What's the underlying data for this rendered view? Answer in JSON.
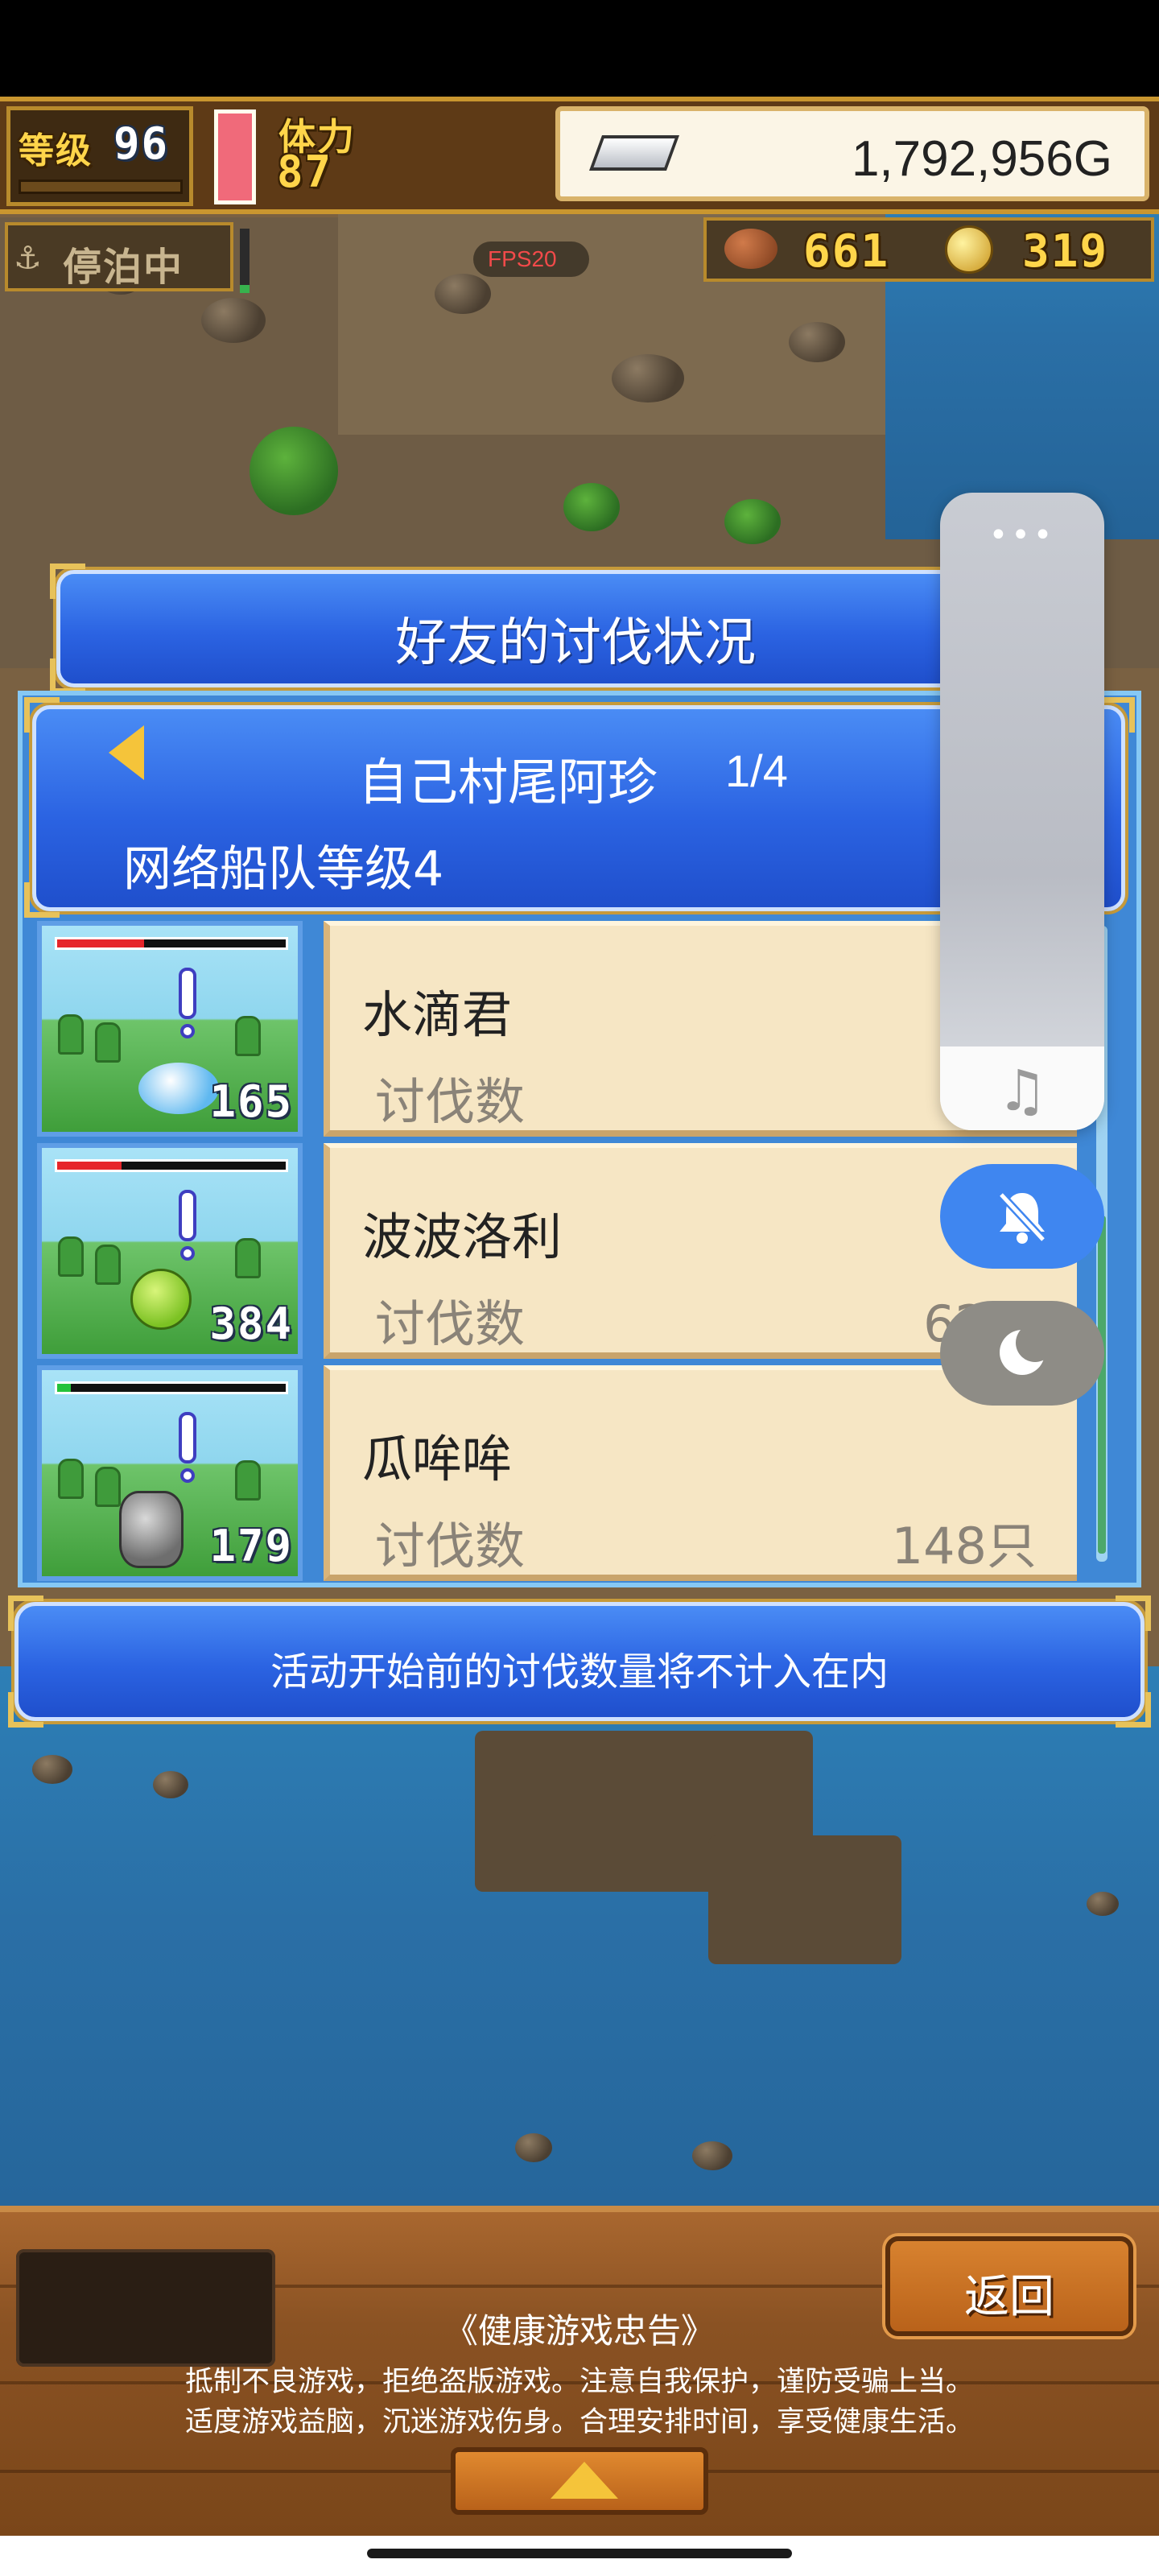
{
  "hud": {
    "level_label": "等级",
    "level_value": "96",
    "stamina_label": "体力",
    "stamina_value": "87",
    "gold": "1,792,956G",
    "anchor_status": "停泊中",
    "fps": "FPS20",
    "resource_food": "661",
    "resource_coin": "319"
  },
  "dialog": {
    "title": "好友的讨伐状况",
    "friend_name": "自己村尾阿珍",
    "page": "1/4",
    "fleet_level": "网络船队等级4",
    "kill_label": "讨伐数",
    "monsters": [
      {
        "name": "水滴君",
        "level": "165",
        "kills": "",
        "hp_fraction": 0.38
      },
      {
        "name": "波波洛利",
        "level": "384",
        "kills": "62只",
        "hp_fraction": 0.28
      },
      {
        "name": "瓜哞哞",
        "level": "179",
        "kills": "148只",
        "hp_fraction": 0.06
      }
    ],
    "notice": "活动开始前的讨伐数量将不计入在内"
  },
  "floating_menu": {
    "more_icon": "more-dots-icon",
    "music_icon": "music-note-icon",
    "mute_icon": "bell-off-icon",
    "night_icon": "moon-icon"
  },
  "bottom": {
    "back_button": "返回",
    "advisory_title": "《健康游戏忠告》",
    "advisory_line1": "抵制不良游戏，拒绝盗版游戏。注意自我保护，谨防受骗上当。",
    "advisory_line2": "适度游戏益脑，沉迷游戏伤身。合理安排时间，享受健康生活。"
  },
  "colors": {
    "dialog_blue": "#2b63e2",
    "gold_frame": "#e7c25a",
    "hp_red": "#e6252a",
    "sea": "#2a6fa6"
  }
}
